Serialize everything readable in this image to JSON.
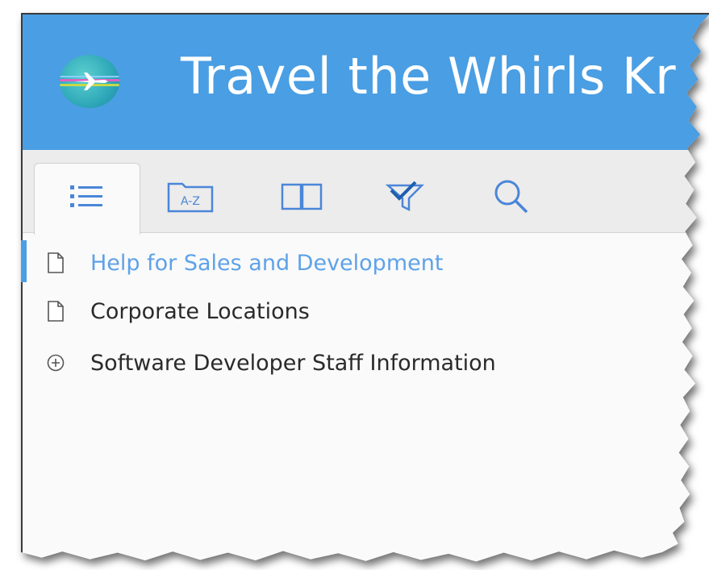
{
  "header": {
    "title": "Travel the Whirls Kr",
    "logo_icon": "globe-airplane-icon",
    "background_color": "#4a9ee3"
  },
  "toolbar": {
    "tabs": [
      {
        "icon": "list-icon",
        "active": true
      },
      {
        "icon": "index-az-icon",
        "label": "A-Z",
        "active": false
      },
      {
        "icon": "book-icon",
        "active": false
      },
      {
        "icon": "filter-icon",
        "active": false
      },
      {
        "icon": "search-icon",
        "active": false
      }
    ]
  },
  "nav": {
    "items": [
      {
        "label": "Help for Sales and Development",
        "icon": "page-icon",
        "active": true
      },
      {
        "label": "Corporate Locations",
        "icon": "page-icon",
        "active": false
      },
      {
        "label": "Software Developer Staff Information",
        "icon": "expand-plus-icon",
        "active": false
      }
    ],
    "active_color": "#5ea2e8"
  }
}
